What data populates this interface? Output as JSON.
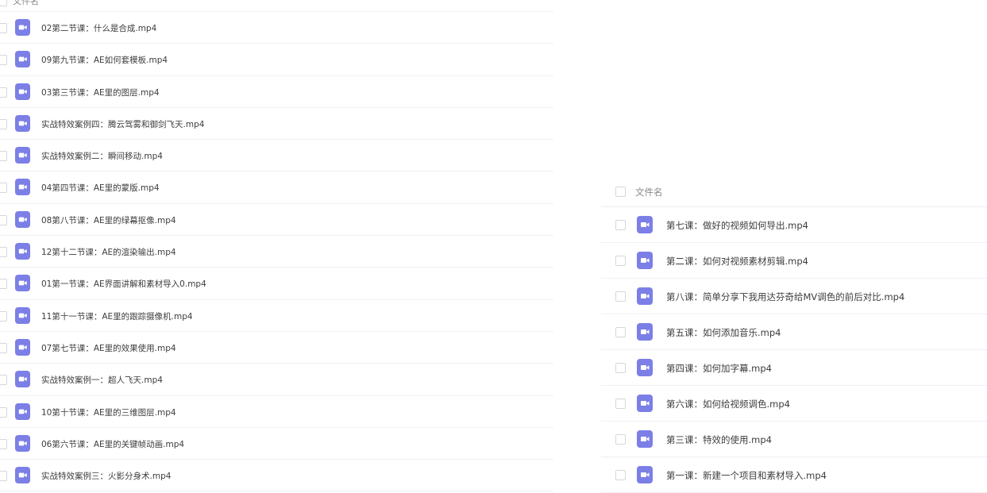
{
  "left_panel": {
    "header_label": "文件名",
    "files": [
      {
        "name": "02第二节课：什么是合成.mp4"
      },
      {
        "name": "09第九节课：AE如何套模板.mp4"
      },
      {
        "name": "03第三节课：AE里的图层.mp4"
      },
      {
        "name": "实战特效案例四：腾云驾雾和御剑飞天.mp4"
      },
      {
        "name": "实战特效案例二：瞬间移动.mp4"
      },
      {
        "name": "04第四节课：AE里的蒙版.mp4"
      },
      {
        "name": "08第八节课：AE里的绿幕抠像.mp4"
      },
      {
        "name": "12第十二节课：AE的渲染输出.mp4"
      },
      {
        "name": "01第一节课：AE界面讲解和素材导入0.mp4"
      },
      {
        "name": "11第十一节课：AE里的跟踪摄像机.mp4"
      },
      {
        "name": "07第七节课：AE里的效果使用.mp4"
      },
      {
        "name": "实战特效案例一：超人飞天.mp4"
      },
      {
        "name": "10第十节课：AE里的三维图层.mp4"
      },
      {
        "name": "06第六节课：AE里的关键帧动画.mp4"
      },
      {
        "name": "实战特效案例三：火影分身术.mp4"
      }
    ]
  },
  "right_panel": {
    "header_label": "文件名",
    "files": [
      {
        "name": "第七课：做好的视频如何导出.mp4"
      },
      {
        "name": "第二课：如何对视频素材剪辑.mp4"
      },
      {
        "name": "第八课：简单分享下我用达芬奇给MV调色的前后对比.mp4"
      },
      {
        "name": "第五课：如何添加音乐.mp4"
      },
      {
        "name": "第四课：如何加字幕.mp4"
      },
      {
        "name": "第六课：如何给视频调色.mp4"
      },
      {
        "name": "第三课：特效的使用.mp4"
      },
      {
        "name": "第一课：新建一个项目和素材导入.mp4"
      }
    ]
  },
  "colors": {
    "video_icon": "#7b7fe6",
    "row_divider": "#eff0f3"
  },
  "icons": {
    "file_type": "video-file-icon",
    "select": "checkbox"
  }
}
